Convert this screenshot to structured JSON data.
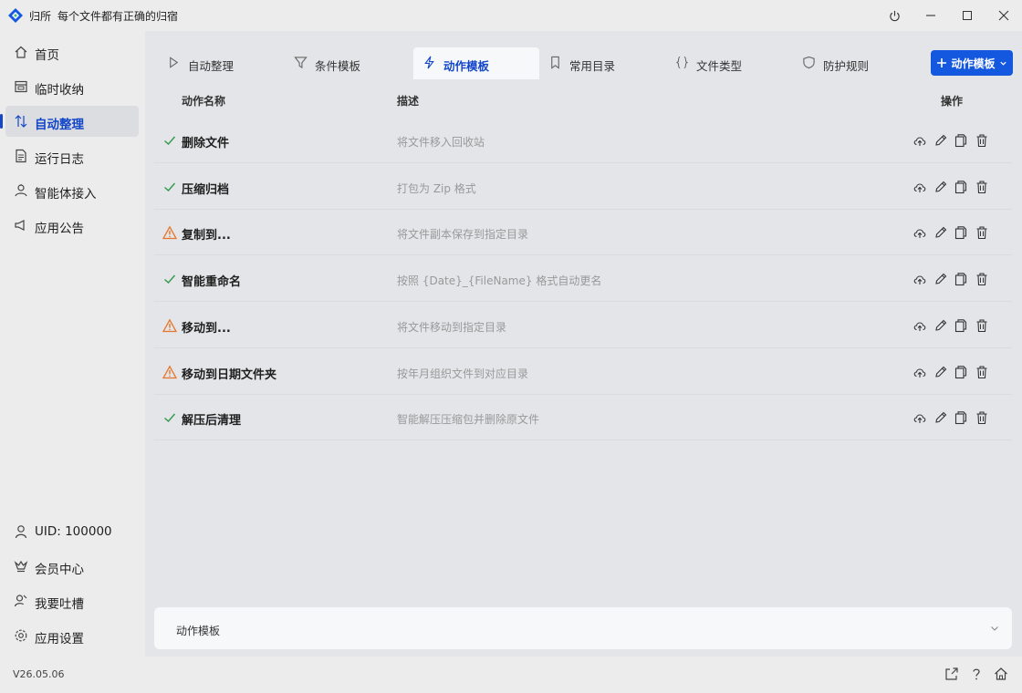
{
  "app": {
    "name": "归所",
    "slogan": "每个文件都有正确的归宿",
    "version": "V26.05.06"
  },
  "window": {
    "buttons": [
      "power-icon",
      "minimize-icon",
      "maximize-icon",
      "close-icon"
    ]
  },
  "sidebar": {
    "items": [
      {
        "label": "首页",
        "icon": "home-icon"
      },
      {
        "label": "临时收纳",
        "icon": "inbox-icon"
      },
      {
        "label": "自动整理",
        "icon": "sort-icon",
        "active": true
      },
      {
        "label": "运行日志",
        "icon": "log-icon"
      },
      {
        "label": "智能体接入",
        "icon": "agent-icon"
      },
      {
        "label": "应用公告",
        "icon": "announce-icon"
      }
    ],
    "bottom_items": [
      {
        "label": "UID: 100000",
        "icon": "user-icon"
      },
      {
        "label": "会员中心",
        "icon": "crown-icon"
      },
      {
        "label": "我要吐槽",
        "icon": "feedback-icon"
      },
      {
        "label": "应用设置",
        "icon": "settings-icon"
      }
    ]
  },
  "tabs": [
    {
      "label": "自动整理",
      "icon": "play-icon"
    },
    {
      "label": "条件模板",
      "icon": "filter-icon"
    },
    {
      "label": "动作模板",
      "icon": "bolt-icon",
      "active": true
    },
    {
      "label": "常用目录",
      "icon": "bookmark-icon"
    },
    {
      "label": "文件类型",
      "icon": "braces-icon"
    },
    {
      "label": "防护规则",
      "icon": "shield-icon"
    }
  ],
  "add_button": {
    "label": "动作模板"
  },
  "table": {
    "headers": {
      "name": "动作名称",
      "desc": "描述",
      "ops": "操作"
    },
    "rows": [
      {
        "name": "删除文件",
        "desc": "将文件移入回收站",
        "status": "ok"
      },
      {
        "name": "压缩归档",
        "desc": "打包为 Zip 格式",
        "status": "ok"
      },
      {
        "name": "复制到...",
        "desc": "将文件副本保存到指定目录",
        "status": "warn"
      },
      {
        "name": "智能重命名",
        "desc": "按照 {Date}_{FileName} 格式自动更名",
        "status": "ok"
      },
      {
        "name": "移动到...",
        "desc": "将文件移动到指定目录",
        "status": "warn"
      },
      {
        "name": "移动到日期文件夹",
        "desc": "按年月组织文件到对应目录",
        "status": "warn"
      },
      {
        "name": "解压后清理",
        "desc": "智能解压压缩包并删除原文件",
        "status": "ok"
      }
    ]
  },
  "footer_panel": {
    "label": "动作模板"
  },
  "colors": {
    "accent": "#1346c8",
    "button": "#1558e0",
    "ok": "#2e9a4a",
    "warn": "#e8742a"
  }
}
